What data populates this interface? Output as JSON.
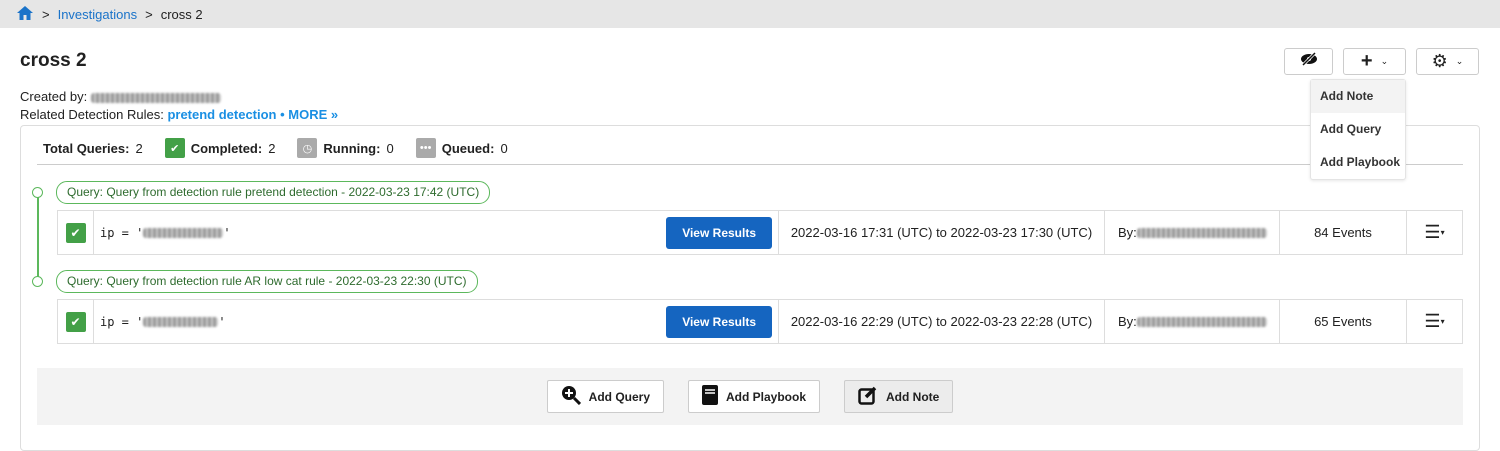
{
  "breadcrumb": {
    "items": [
      "Investigations",
      "cross 2"
    ],
    "sep": ">"
  },
  "title": "cross 2",
  "created_by_label": "Created by:",
  "rules_label": "Related Detection Rules:",
  "rule_link": "pretend detection",
  "more_link": "• MORE »",
  "menu": [
    "Add Note",
    "Add Query",
    "Add Playbook"
  ],
  "stats": {
    "total_label": "Total Queries:",
    "total": "2",
    "completed_label": "Completed:",
    "completed": "2",
    "running_label": "Running:",
    "running": "0",
    "queued_label": "Queued:",
    "queued": "0"
  },
  "queries": [
    {
      "tag": "Query: Query from detection rule pretend detection - 2022-03-23 17:42 (UTC)",
      "query": "ip = '",
      "button": "View Results",
      "range": "2022-03-16 17:31 (UTC) to 2022-03-23 17:30 (UTC)",
      "by": "By:",
      "events": "84 Events"
    },
    {
      "tag": "Query: Query from detection rule AR low cat rule - 2022-03-23 22:30 (UTC)",
      "query": "ip = '",
      "button": "View Results",
      "range": "2022-03-16 22:29 (UTC) to 2022-03-23 22:28 (UTC)",
      "by": "By:",
      "events": "65 Events"
    }
  ],
  "bottom": {
    "add_query": "Add Query",
    "add_playbook": "Add Playbook",
    "add_note": "Add Note"
  },
  "colors": {
    "accent": "#1565c0",
    "success": "#43a047",
    "link": "#1a73c9"
  }
}
